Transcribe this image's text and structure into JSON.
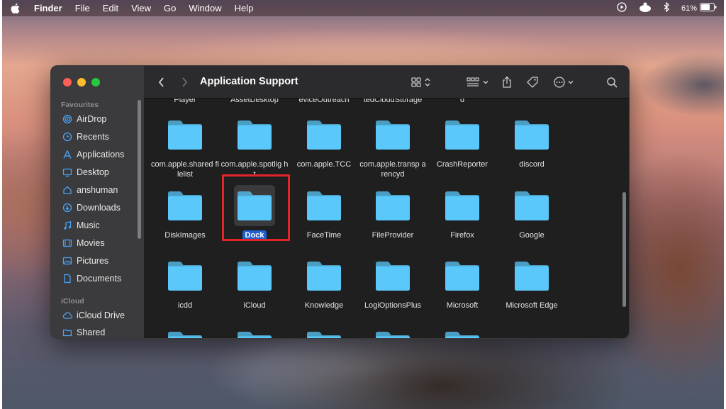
{
  "menubar": {
    "app": "Finder",
    "items": [
      "File",
      "Edit",
      "View",
      "Go",
      "Window",
      "Help"
    ],
    "battery": "61%"
  },
  "window": {
    "title": "Application Support",
    "sidebar": {
      "favourites_heading": "Favourites",
      "favourites": [
        {
          "label": "AirDrop",
          "icon": "airdrop-icon"
        },
        {
          "label": "Recents",
          "icon": "clock-icon"
        },
        {
          "label": "Applications",
          "icon": "applications-icon"
        },
        {
          "label": "Desktop",
          "icon": "desktop-icon"
        },
        {
          "label": "anshuman",
          "icon": "home-icon"
        },
        {
          "label": "Downloads",
          "icon": "download-icon"
        },
        {
          "label": "Music",
          "icon": "music-icon"
        },
        {
          "label": "Movies",
          "icon": "movies-icon"
        },
        {
          "label": "Pictures",
          "icon": "pictures-icon"
        },
        {
          "label": "Documents",
          "icon": "document-icon"
        }
      ],
      "icloud_heading": "iCloud",
      "icloud": [
        {
          "label": "iCloud Drive",
          "icon": "cloud-icon"
        },
        {
          "label": "Shared",
          "icon": "shared-folder-icon"
        }
      ]
    },
    "top_row_labels": [
      "Player",
      "AssetDesktop",
      "eviceOutreach",
      "tedCloudStorage",
      "d"
    ],
    "folders": [
      {
        "label": "com.apple.shared filelist",
        "selected": false
      },
      {
        "label": "com.apple.spotlig ht",
        "selected": false
      },
      {
        "label": "com.apple.TCC",
        "selected": false
      },
      {
        "label": "com.apple.transp arencyd",
        "selected": false
      },
      {
        "label": "CrashReporter",
        "selected": false
      },
      {
        "label": "discord",
        "selected": false
      },
      {
        "label": "DiskImages",
        "selected": false
      },
      {
        "label": "Dock",
        "selected": true
      },
      {
        "label": "FaceTime",
        "selected": false
      },
      {
        "label": "FileProvider",
        "selected": false
      },
      {
        "label": "Firefox",
        "selected": false
      },
      {
        "label": "Google",
        "selected": false
      },
      {
        "label": "icdd",
        "selected": false
      },
      {
        "label": "iCloud",
        "selected": false
      },
      {
        "label": "Knowledge",
        "selected": false
      },
      {
        "label": "LogiOptionsPlus",
        "selected": false
      },
      {
        "label": "Microsoft",
        "selected": false
      },
      {
        "label": "Microsoft Edge",
        "selected": false
      }
    ],
    "folder_color": "#5ac8fa",
    "selection_color": "#1f5fcf",
    "annotation_color": "#e3242b"
  }
}
